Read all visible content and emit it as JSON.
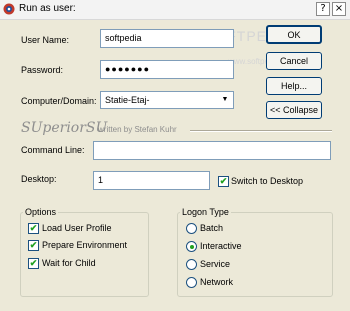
{
  "window": {
    "title": "Run as user:",
    "controls": [
      "?",
      "×"
    ]
  },
  "form": {
    "username_label": "User Name:",
    "username_value": "softpedia",
    "password_label": "Password:",
    "password_value": "●●●●●●●",
    "computer_label": "Computer/Domain:",
    "computer_value": "Statie-Etaj-",
    "command_label": "Command Line:",
    "command_value": "",
    "desktop_label": "Desktop:",
    "desktop_value": "1"
  },
  "buttons": {
    "ok": "OK",
    "cancel": "Cancel",
    "help": "Help...",
    "collapse": "<< Collapse"
  },
  "branding": {
    "logo": "SUperiorSU",
    "written_by": "written by Stefan Kuhr"
  },
  "watermark": {
    "main": "SOFTPEDIA",
    "sub": "www.softpedia.com"
  },
  "switch_to_desktop": {
    "label": "Switch to Desktop",
    "checked": true
  },
  "options": {
    "title": "Options",
    "items": [
      {
        "label": "Load User Profile",
        "checked": true
      },
      {
        "label": "Prepare Environment",
        "checked": true
      },
      {
        "label": "Wait for Child",
        "checked": true
      }
    ]
  },
  "logon_type": {
    "title": "Logon Type",
    "items": [
      {
        "label": "Batch",
        "selected": false
      },
      {
        "label": "Interactive",
        "selected": true
      },
      {
        "label": "Service",
        "selected": false
      },
      {
        "label": "Network",
        "selected": false
      }
    ]
  },
  "colors": {
    "accent": "#003c74",
    "check": "#21a121",
    "face": "#ece9d8"
  }
}
